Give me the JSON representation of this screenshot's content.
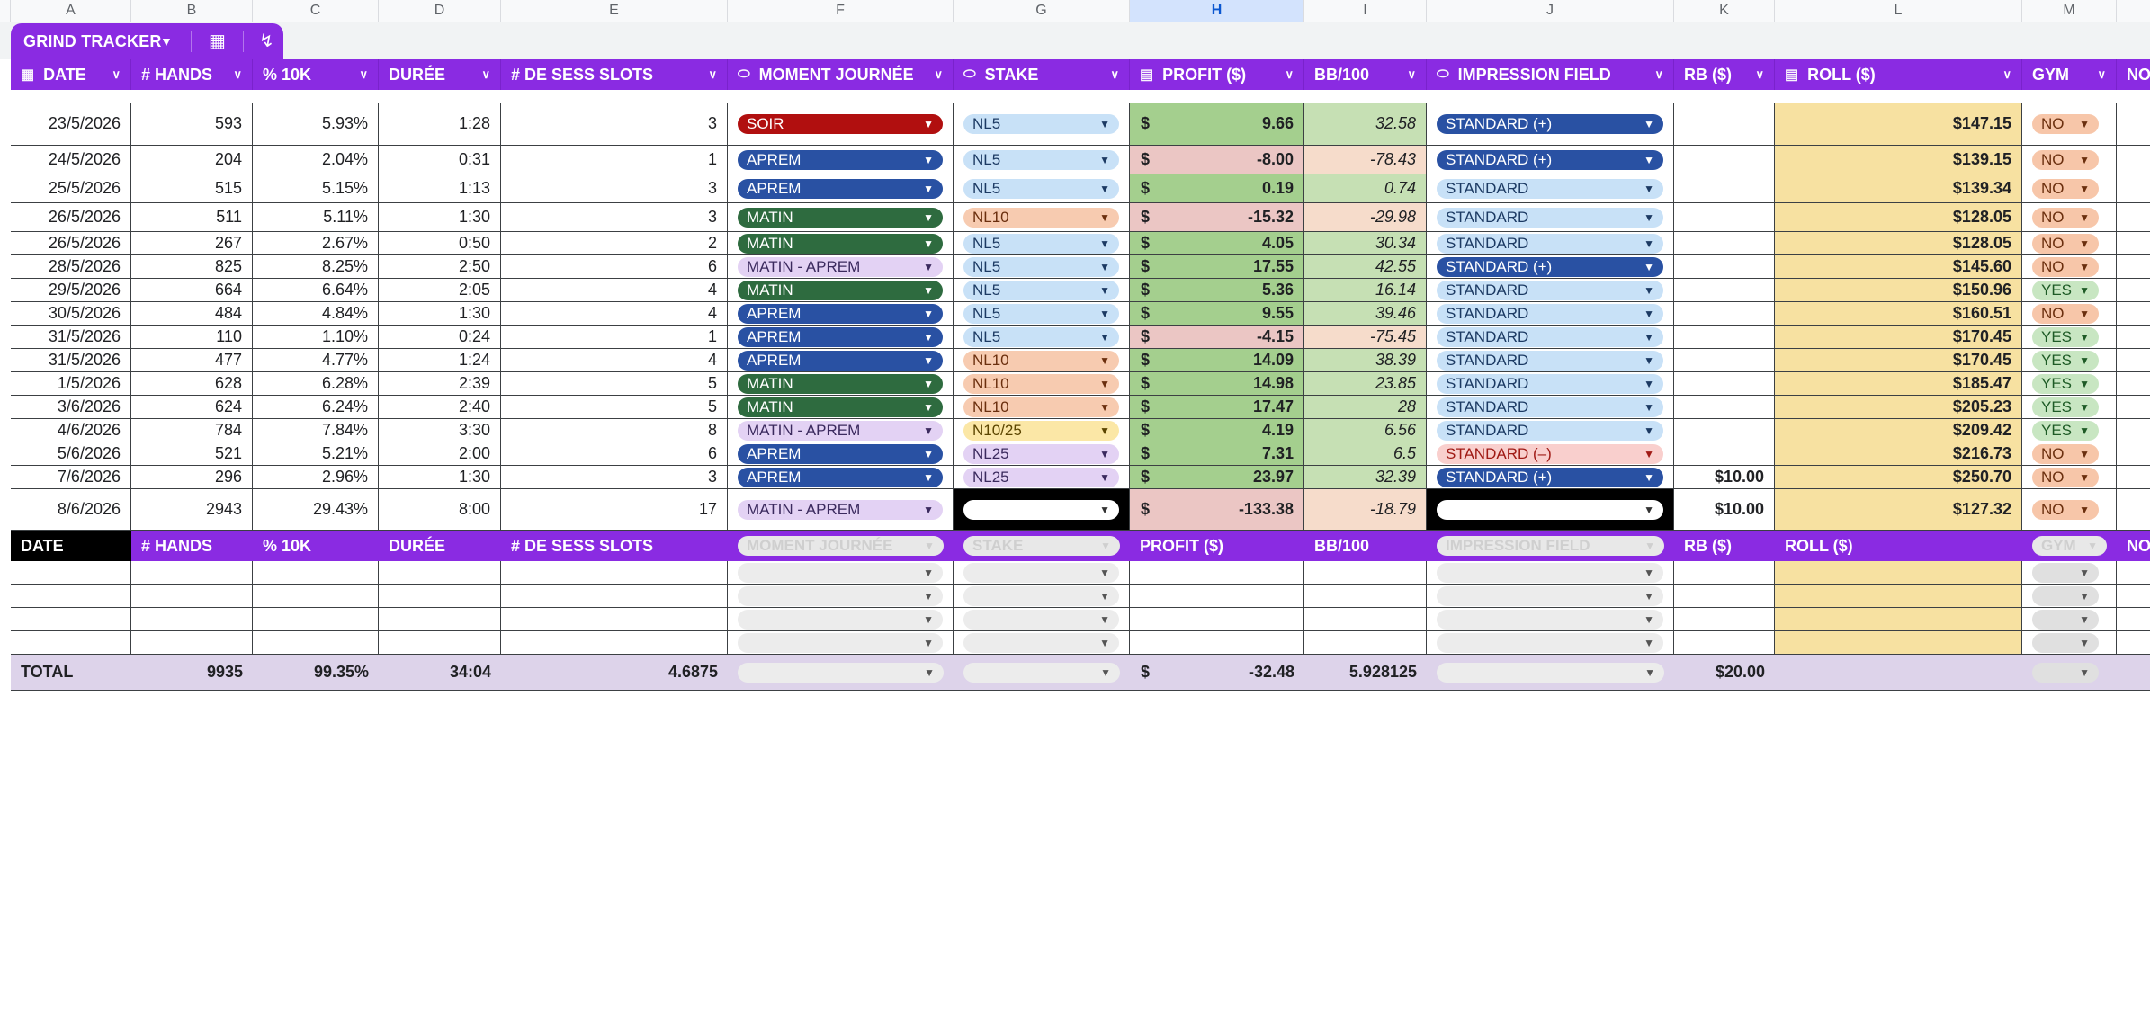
{
  "column_letters": [
    "A",
    "B",
    "C",
    "D",
    "E",
    "F",
    "G",
    "H",
    "I",
    "J",
    "K",
    "L",
    "M"
  ],
  "selected_column": "H",
  "tab": {
    "title": "GRIND TRACKER"
  },
  "headers": {
    "date": "DATE",
    "hands": "# HANDS",
    "pct": "% 10K",
    "duree": "DURÉE",
    "sess": "# DE SESS SLOTS",
    "moment": "MOMENT JOURNÉE",
    "stake": "STAKE",
    "profit": "PROFIT ($)",
    "bb": "BB/100",
    "impression": "IMPRESSION FIELD",
    "rb": "RB ($)",
    "roll": "ROLL ($)",
    "gym": "GYM",
    "notes": "NOTES"
  },
  "rows": [
    {
      "date": "23/5/2026",
      "hands": "593",
      "pct": "5.93%",
      "duree": "1:28",
      "sess": "3",
      "moment": "SOIR",
      "stake": "NL5",
      "profit": "9.66",
      "bb": "32.58",
      "impression": "STANDARD (+)",
      "rb": "",
      "roll": "$147.15",
      "gym": "NO"
    },
    {
      "date": "24/5/2026",
      "hands": "204",
      "pct": "2.04%",
      "duree": "0:31",
      "sess": "1",
      "moment": "APREM",
      "stake": "NL5",
      "profit": "-8.00",
      "bb": "-78.43",
      "impression": "STANDARD (+)",
      "rb": "",
      "roll": "$139.15",
      "gym": "NO"
    },
    {
      "date": "25/5/2026",
      "hands": "515",
      "pct": "5.15%",
      "duree": "1:13",
      "sess": "3",
      "moment": "APREM",
      "stake": "NL5",
      "profit": "0.19",
      "bb": "0.74",
      "impression": "STANDARD",
      "rb": "",
      "roll": "$139.34",
      "gym": "NO"
    },
    {
      "date": "26/5/2026",
      "hands": "511",
      "pct": "5.11%",
      "duree": "1:30",
      "sess": "3",
      "moment": "MATIN",
      "stake": "NL10",
      "profit": "-15.32",
      "bb": "-29.98",
      "impression": "STANDARD",
      "rb": "",
      "roll": "$128.05",
      "gym": "NO"
    },
    {
      "date": "26/5/2026",
      "hands": "267",
      "pct": "2.67%",
      "duree": "0:50",
      "sess": "2",
      "moment": "MATIN",
      "stake": "NL5",
      "profit": "4.05",
      "bb": "30.34",
      "impression": "STANDARD",
      "rb": "",
      "roll": "$128.05",
      "gym": "NO"
    },
    {
      "date": "28/5/2026",
      "hands": "825",
      "pct": "8.25%",
      "duree": "2:50",
      "sess": "6",
      "moment": "MATIN - APREM",
      "stake": "NL5",
      "profit": "17.55",
      "bb": "42.55",
      "impression": "STANDARD (+)",
      "rb": "",
      "roll": "$145.60",
      "gym": "NO"
    },
    {
      "date": "29/5/2026",
      "hands": "664",
      "pct": "6.64%",
      "duree": "2:05",
      "sess": "4",
      "moment": "MATIN",
      "stake": "NL5",
      "profit": "5.36",
      "bb": "16.14",
      "impression": "STANDARD",
      "rb": "",
      "roll": "$150.96",
      "gym": "YES"
    },
    {
      "date": "30/5/2026",
      "hands": "484",
      "pct": "4.84%",
      "duree": "1:30",
      "sess": "4",
      "moment": "APREM",
      "stake": "NL5",
      "profit": "9.55",
      "bb": "39.46",
      "impression": "STANDARD",
      "rb": "",
      "roll": "$160.51",
      "gym": "NO"
    },
    {
      "date": "31/5/2026",
      "hands": "110",
      "pct": "1.10%",
      "duree": "0:24",
      "sess": "1",
      "moment": "APREM",
      "stake": "NL5",
      "profit": "-4.15",
      "bb": "-75.45",
      "impression": "STANDARD",
      "rb": "",
      "roll": "$170.45",
      "gym": "YES"
    },
    {
      "date": "31/5/2026",
      "hands": "477",
      "pct": "4.77%",
      "duree": "1:24",
      "sess": "4",
      "moment": "APREM",
      "stake": "NL10",
      "profit": "14.09",
      "bb": "38.39",
      "impression": "STANDARD",
      "rb": "",
      "roll": "$170.45",
      "gym": "YES"
    },
    {
      "date": "1/5/2026",
      "hands": "628",
      "pct": "6.28%",
      "duree": "2:39",
      "sess": "5",
      "moment": "MATIN",
      "stake": "NL10",
      "profit": "14.98",
      "bb": "23.85",
      "impression": "STANDARD",
      "rb": "",
      "roll": "$185.47",
      "gym": "YES"
    },
    {
      "date": "3/6/2026",
      "hands": "624",
      "pct": "6.24%",
      "duree": "2:40",
      "sess": "5",
      "moment": "MATIN",
      "stake": "NL10",
      "profit": "17.47",
      "bb": "28",
      "impression": "STANDARD",
      "rb": "",
      "roll": "$205.23",
      "gym": "YES"
    },
    {
      "date": "4/6/2026",
      "hands": "784",
      "pct": "7.84%",
      "duree": "3:30",
      "sess": "8",
      "moment": "MATIN - APREM",
      "stake": "N10/25",
      "profit": "4.19",
      "bb": "6.56",
      "impression": "STANDARD",
      "rb": "",
      "roll": "$209.42",
      "gym": "YES"
    },
    {
      "date": "5/6/2026",
      "hands": "521",
      "pct": "5.21%",
      "duree": "2:00",
      "sess": "6",
      "moment": "APREM",
      "stake": "NL25",
      "profit": "7.31",
      "bb": "6.5",
      "impression": "STANDARD (–)",
      "rb": "",
      "roll": "$216.73",
      "gym": "NO"
    },
    {
      "date": "7/6/2026",
      "hands": "296",
      "pct": "2.96%",
      "duree": "1:30",
      "sess": "3",
      "moment": "APREM",
      "stake": "NL25",
      "profit": "23.97",
      "bb": "32.39",
      "impression": "STANDARD (+)",
      "rb": "$10.00",
      "roll": "$250.70",
      "gym": "NO"
    },
    {
      "date": "8/6/2026",
      "hands": "2943",
      "pct": "29.43%",
      "duree": "8:00",
      "sess": "17",
      "moment": "MATIN - APREM",
      "stake": "",
      "profit": "-133.38",
      "bb": "-18.79",
      "impression": "",
      "rb": "$10.00",
      "roll": "$127.32",
      "gym": "NO"
    }
  ],
  "second_header": {
    "date": "DATE",
    "hands": "# HANDS",
    "pct": "% 10K",
    "duree": "DURÉE",
    "sess": "# DE SESS SLOTS",
    "moment": "MOMENT JOURNÉE",
    "stake": "STAKE",
    "profit": "PROFIT ($)",
    "bb": "BB/100",
    "impression": "IMPRESSION FIELD",
    "rb": "RB ($)",
    "roll": "ROLL ($)",
    "gym": "GYM",
    "notes": "NO"
  },
  "total": {
    "label": "TOTAL",
    "hands": "9935",
    "pct": "99.35%",
    "duree": "34:04",
    "sess": "4.6875",
    "dollar": "$",
    "profit": "-32.48",
    "bb": "5.928125",
    "rb": "$20.00"
  },
  "currency": "$",
  "colors": {
    "header": "#8a2be2",
    "profit_pos": "#a4cf8e",
    "profit_neg": "#ebc6c4",
    "roll": "#f7e1a1",
    "total": "#ddd3ea"
  }
}
